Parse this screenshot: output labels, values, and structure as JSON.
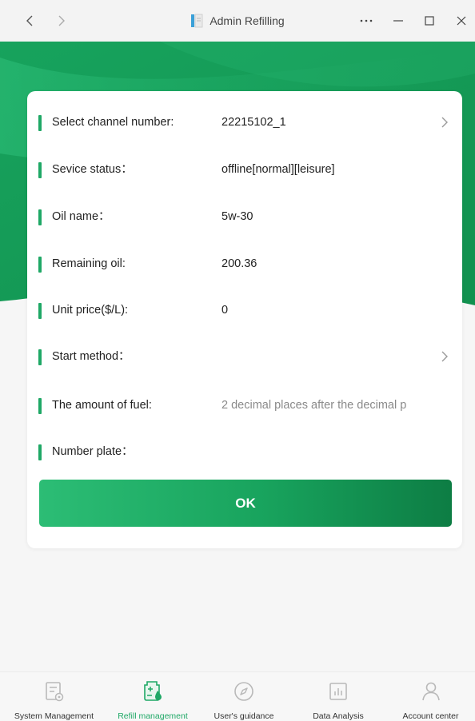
{
  "window": {
    "title": "Admin Refilling"
  },
  "form": {
    "rows": [
      {
        "label": "Select channel number:",
        "value": "22215102_1",
        "has_chevron": true
      },
      {
        "label": "Sevice status：",
        "value": "offline[normal][leisure]",
        "has_chevron": false
      },
      {
        "label": "Oil name：",
        "value": "5w-30",
        "has_chevron": false
      },
      {
        "label": "Remaining oil:",
        "value": "200.36",
        "has_chevron": false
      },
      {
        "label": "Unit price($/L):",
        "value": "0",
        "has_chevron": false
      },
      {
        "label": "Start method：",
        "value": "",
        "has_chevron": true
      },
      {
        "label": "The amount of fuel:",
        "placeholder": "2 decimal places after the decimal p",
        "has_chevron": false
      },
      {
        "label": "Number plate：",
        "value": "",
        "has_chevron": false
      }
    ],
    "ok_label": "OK"
  },
  "bottom_nav": [
    {
      "label": "System Management",
      "icon": "system-management-icon",
      "active": false
    },
    {
      "label": "Refill management",
      "icon": "refill-management-icon",
      "active": true
    },
    {
      "label": "User's guidance",
      "icon": "compass-icon",
      "active": false
    },
    {
      "label": "Data Analysis",
      "icon": "bar-chart-icon",
      "active": false
    },
    {
      "label": "Account center",
      "icon": "person-icon",
      "active": false
    }
  ],
  "colors": {
    "accent": "#1fa866",
    "header_green": "#1aa662",
    "inactive_icon": "#b9b9b9"
  }
}
